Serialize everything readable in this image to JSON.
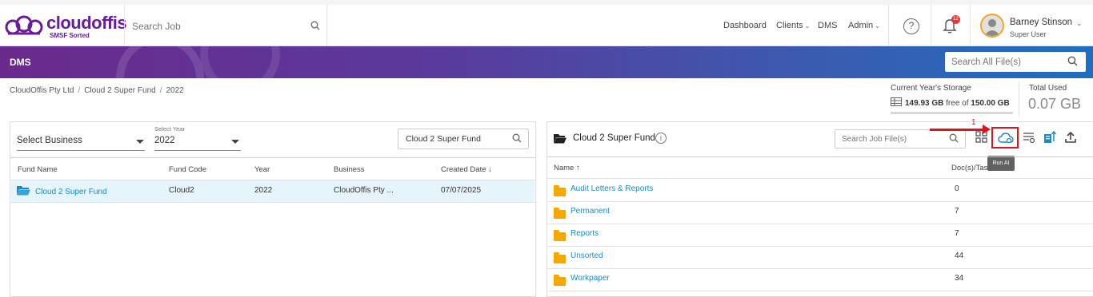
{
  "brand": {
    "name": "cloudoffis",
    "tagline": "SMSF Sorted",
    "color": "#6a1b9a"
  },
  "header": {
    "search_placeholder": "Search Job",
    "nav": {
      "dashboard": "Dashboard",
      "clients": "Clients",
      "dms": "DMS",
      "admin": "Admin"
    },
    "help_label": "?",
    "notification_count": "12",
    "user": {
      "name": "Barney Stinson",
      "role": "Super User"
    }
  },
  "banner": {
    "title": "DMS",
    "search_placeholder": "Search All File(s)"
  },
  "breadcrumb": [
    "CloudOffis Pty Ltd",
    "Cloud 2 Super Fund",
    "2022"
  ],
  "breadcrumb_sep": "/",
  "storage": {
    "label": "Current Year's Storage",
    "free": "149.93 GB",
    "free_text": "free of",
    "total": "150.00 GB",
    "total_used_label": "Total Used",
    "total_used": "0.07 GB"
  },
  "left_panel": {
    "business_select": "Select Business",
    "year_label": "Select Year",
    "year_value": "2022",
    "fund_search_value": "Cloud 2 Super Fund",
    "columns": {
      "fund_name": "Fund Name",
      "fund_code": "Fund Code",
      "year": "Year",
      "business": "Business",
      "created": "Created Date"
    },
    "sort_indicator": "↓",
    "rows": [
      {
        "fund_name": "Cloud 2 Super Fund",
        "fund_code": "Cloud2",
        "year": "2022",
        "business": "CloudOffis Pty ...",
        "created": "07/07/2025"
      }
    ]
  },
  "right_panel": {
    "title": "Cloud 2 Super Fund",
    "info": "i",
    "search_placeholder": "Search Job File(s)",
    "tooltip": "Run AI",
    "step_number": "1",
    "columns": {
      "name": "Name",
      "docs": "Doc(s)/Tas"
    },
    "sort_indicator": "↑",
    "folders": [
      {
        "name": "Audit Letters & Reports",
        "count": "0"
      },
      {
        "name": "Permanent",
        "count": "7"
      },
      {
        "name": "Reports",
        "count": "7"
      },
      {
        "name": "Unsorted",
        "count": "44"
      },
      {
        "name": "Workpaper",
        "count": "34"
      }
    ]
  },
  "colors": {
    "accent_blue": "#1a8ac8",
    "highlight_red": "#e0131a",
    "folder": "#f5a800",
    "banner_start": "#6a2a8c",
    "banner_end": "#1f6dc0"
  }
}
